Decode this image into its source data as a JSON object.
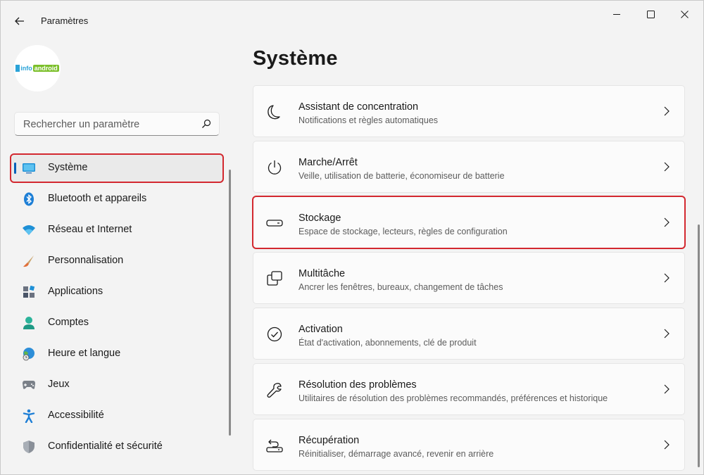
{
  "window": {
    "title": "Paramètres"
  },
  "sidebar": {
    "search_placeholder": "Rechercher un paramètre",
    "items": [
      {
        "label": "Système",
        "icon": "system-icon",
        "active": true
      },
      {
        "label": "Bluetooth et appareils",
        "icon": "bluetooth-icon"
      },
      {
        "label": "Réseau et Internet",
        "icon": "wifi-icon"
      },
      {
        "label": "Personnalisation",
        "icon": "brush-icon"
      },
      {
        "label": "Applications",
        "icon": "apps-icon"
      },
      {
        "label": "Comptes",
        "icon": "account-icon"
      },
      {
        "label": "Heure et langue",
        "icon": "globe-clock-icon"
      },
      {
        "label": "Jeux",
        "icon": "gamepad-icon"
      },
      {
        "label": "Accessibilité",
        "icon": "accessibility-icon"
      },
      {
        "label": "Confidentialité et sécurité",
        "icon": "shield-icon"
      }
    ]
  },
  "main": {
    "title": "Système",
    "cards": [
      {
        "title": "Assistant de concentration",
        "subtitle": "Notifications et règles automatiques",
        "icon": "moon-icon"
      },
      {
        "title": "Marche/Arrêt",
        "subtitle": "Veille, utilisation de batterie, économiseur de batterie",
        "icon": "power-icon"
      },
      {
        "title": "Stockage",
        "subtitle": "Espace de stockage, lecteurs, règles de configuration",
        "icon": "storage-icon",
        "highlighted": true
      },
      {
        "title": "Multitâche",
        "subtitle": "Ancrer les fenêtres, bureaux, changement de tâches",
        "icon": "multitask-icon"
      },
      {
        "title": "Activation",
        "subtitle": "État d'activation, abonnements, clé de produit",
        "icon": "check-circle-icon"
      },
      {
        "title": "Résolution des problèmes",
        "subtitle": "Utilitaires de résolution des problèmes recommandés, préférences et historique",
        "icon": "wrench-icon"
      },
      {
        "title": "Récupération",
        "subtitle": "Réinitialiser, démarrage avancé, revenir en arrière",
        "icon": "recovery-icon"
      }
    ]
  },
  "colors": {
    "accent": "#005fb8",
    "highlight": "#d3282f",
    "background": "#f3f3f3",
    "card": "#fbfbfb"
  }
}
